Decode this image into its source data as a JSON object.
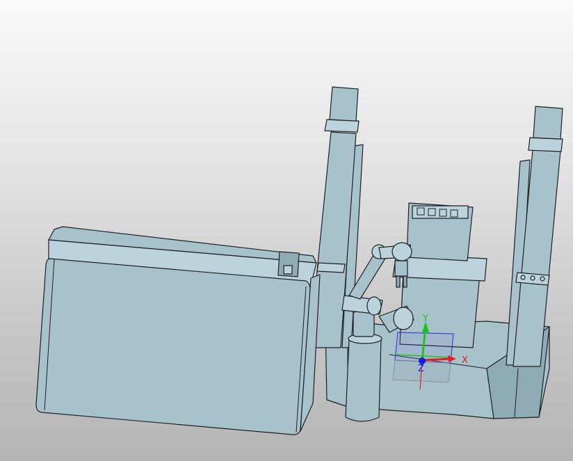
{
  "viewport": {
    "background": [
      "#fafafa",
      "#b5b5b5"
    ],
    "part_color": "#a8c2cc",
    "edge_color": "#1a1f22"
  },
  "triad": {
    "x_label": "X",
    "y_label": "Y",
    "z_label": "Z",
    "x_color": "#e02020",
    "y_color": "#20c020",
    "z_color": "#2020e0"
  }
}
